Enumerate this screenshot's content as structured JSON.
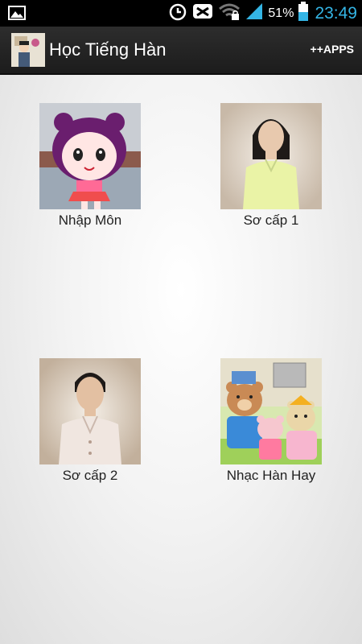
{
  "status_bar": {
    "battery_percent": "51%",
    "time": "23:49",
    "icons": [
      "gallery-icon",
      "alarm-icon",
      "muted-icon",
      "wifi-lock-icon",
      "signal-icon",
      "battery-icon"
    ]
  },
  "action_bar": {
    "title": "Học Tiếng Hàn",
    "apps_label": "++APPS"
  },
  "tiles": [
    {
      "label": "Nhập Môn",
      "icon": "cartoon-girl-image"
    },
    {
      "label": "Sơ cấp 1",
      "icon": "woman-teacher-image"
    },
    {
      "label": "Sơ cấp 2",
      "icon": "man-teacher-image"
    },
    {
      "label": "Nhạc Hàn Hay",
      "icon": "bear-family-image"
    }
  ],
  "colors": {
    "clock": "#34b5e5",
    "action_bar": "#222222"
  }
}
